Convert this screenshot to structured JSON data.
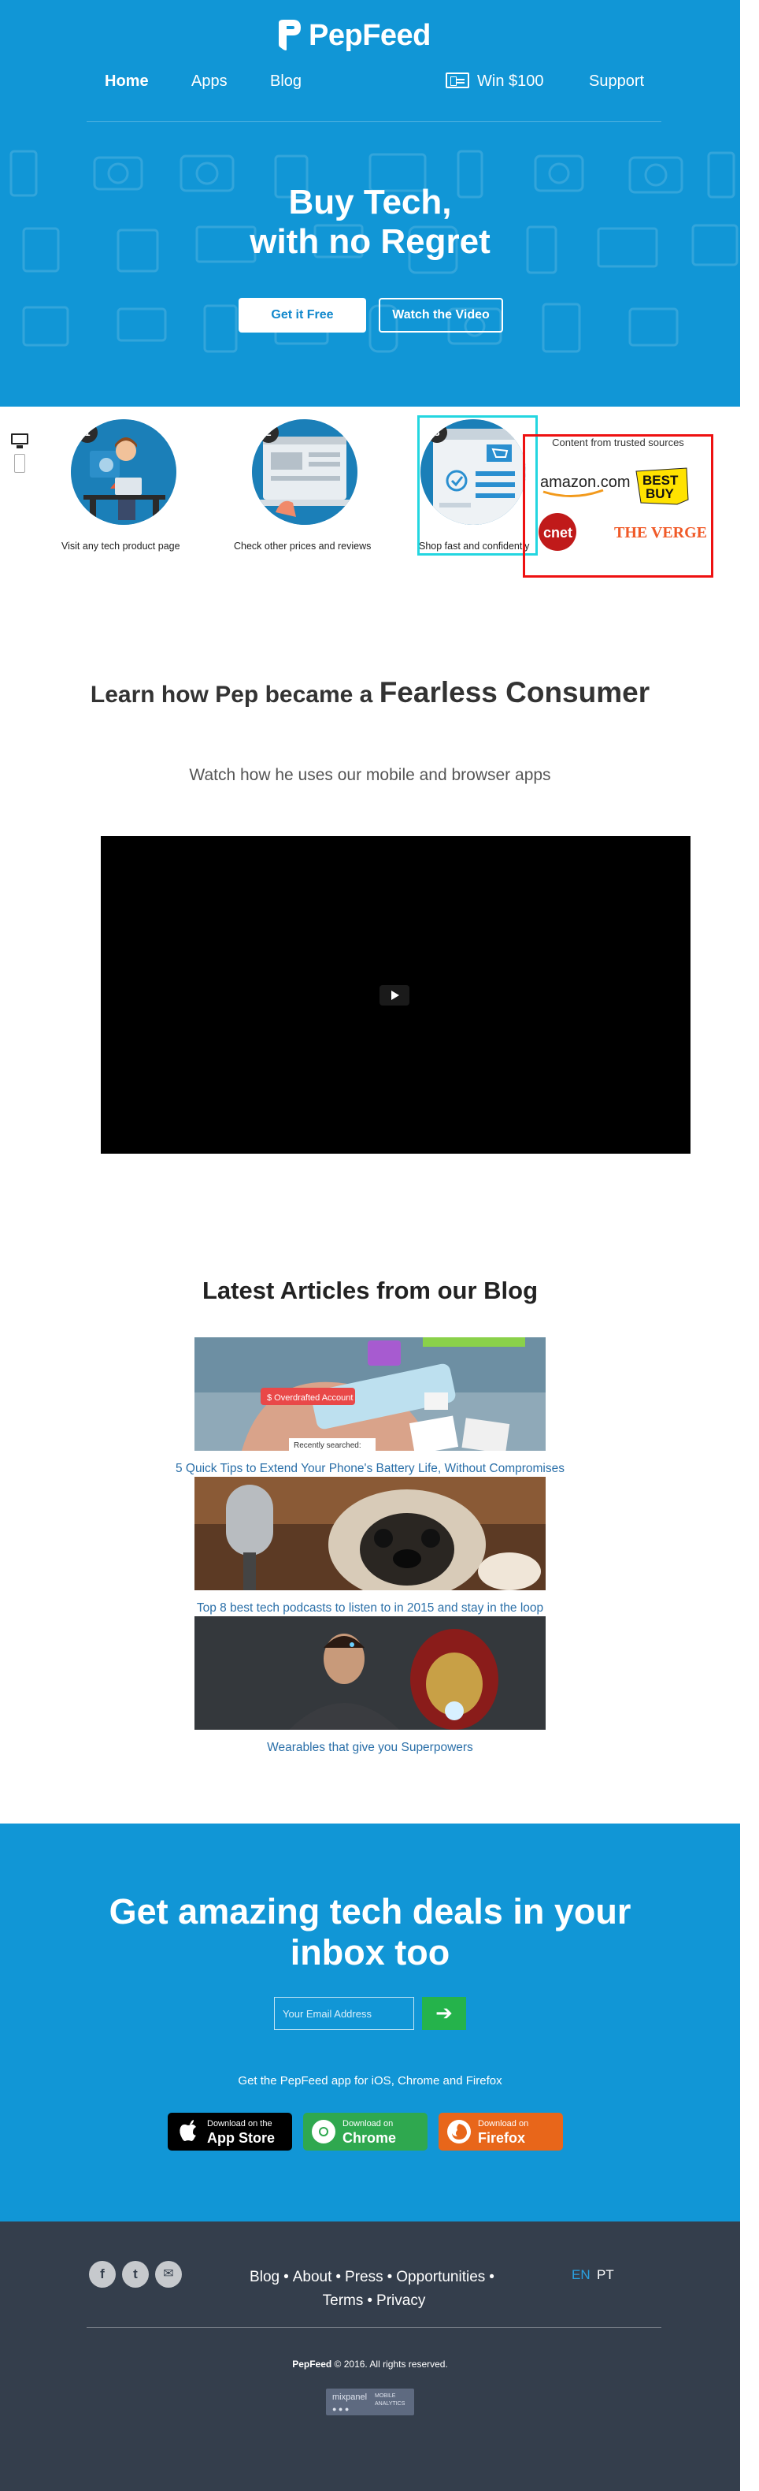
{
  "brand": {
    "name": "PepFeed"
  },
  "nav": {
    "home": "Home",
    "apps": "Apps",
    "blog": "Blog",
    "win": "Win $100",
    "support": "Support"
  },
  "hero": {
    "title_line1": "Buy Tech,",
    "title_line2": "with no Regret",
    "get_free": "Get it Free",
    "watch_video": "Watch the Video"
  },
  "steps": [
    {
      "number": "1",
      "caption": "Visit any tech product page"
    },
    {
      "number": "2",
      "caption": "Check other prices and reviews"
    },
    {
      "number": "3",
      "caption": "Shop fast and confidently"
    }
  ],
  "trusted": {
    "label": "Content from trusted sources",
    "logos": [
      "amazon.com",
      "BEST BUY",
      "cnet",
      "THE VERGE"
    ]
  },
  "fearless": {
    "lead": "Learn how Pep became a",
    "emphasis": "Fearless Consumer",
    "subtitle": "Watch how he uses our mobile and browser apps"
  },
  "blog": {
    "title": "Latest Articles from our Blog",
    "articles": [
      {
        "title": "5 Quick Tips to Extend Your Phone's Battery Life, Without Compromises",
        "img_text_1": "$ Overdrafted Account",
        "img_text_2": "Recently searched:"
      },
      {
        "title": "Top 8 best tech podcasts to listen to in 2015 and stay in the loop"
      },
      {
        "title": "Wearables that give you Superpowers"
      }
    ]
  },
  "newsletter": {
    "title_line1": "Get amazing tech deals in your",
    "title_line2": "inbox too",
    "email_placeholder": "Your Email Address",
    "submit_arrow": "➔",
    "get_app": "Get the PepFeed app for iOS, Chrome and Firefox",
    "stores": [
      {
        "small": "Download on the",
        "big": "App Store",
        "color": "#000000"
      },
      {
        "small": "Download on",
        "big": "Chrome",
        "color": "#2fa84f"
      },
      {
        "small": "Download on",
        "big": "Firefox",
        "color": "#e8661a"
      }
    ]
  },
  "footer": {
    "social": [
      "f",
      "t",
      "✉"
    ],
    "links": [
      "Blog",
      "About",
      "Press",
      "Opportunities",
      "Terms",
      "Privacy"
    ],
    "separator": "•",
    "lang_en": "EN",
    "lang_pt": "PT",
    "copyright_brand": "PepFeed",
    "copyright_rest": "© 2016. All rights reserved.",
    "mixpanel_line1": "mixpanel",
    "mixpanel_line2": "MOBILE",
    "mixpanel_line3": "ANALYTICS"
  },
  "colors": {
    "brand_blue": "#1196d6",
    "footer_bg": "#343e4c",
    "link_blue": "#2a6fa8",
    "go_green": "#25b34b",
    "highlight_cyan": "#23d6e0",
    "highlight_red": "#ee1111"
  }
}
